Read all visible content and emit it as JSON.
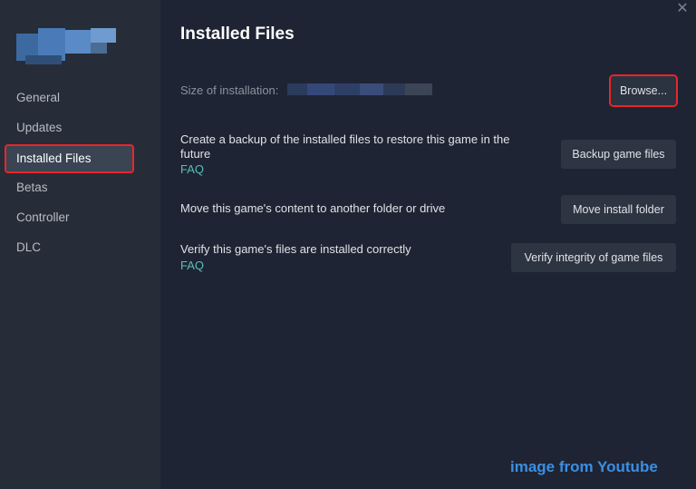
{
  "sidebar": {
    "items": [
      {
        "label": "General"
      },
      {
        "label": "Updates"
      },
      {
        "label": "Installed Files"
      },
      {
        "label": "Betas"
      },
      {
        "label": "Controller"
      },
      {
        "label": "DLC"
      }
    ],
    "active_index": 2
  },
  "main": {
    "title": "Installed Files",
    "size_label": "Size of installation:",
    "browse_label": "Browse...",
    "sections": [
      {
        "description": "Create a backup of the installed files to restore this game in the future",
        "faq": "FAQ",
        "button": "Backup game files"
      },
      {
        "description": "Move this game's content to another folder or drive",
        "button": "Move install folder"
      },
      {
        "description": "Verify this game's files are installed correctly",
        "faq": "FAQ",
        "button": "Verify integrity of game files"
      }
    ]
  },
  "watermark": "image from Youtube",
  "colors": {
    "sidebar_bg": "#262d38",
    "main_bg": "#1e2433",
    "highlight": "#e8262a",
    "faq_link": "#59bfb6",
    "watermark": "#3b8fe4"
  },
  "icons": {
    "close": "close-icon"
  }
}
